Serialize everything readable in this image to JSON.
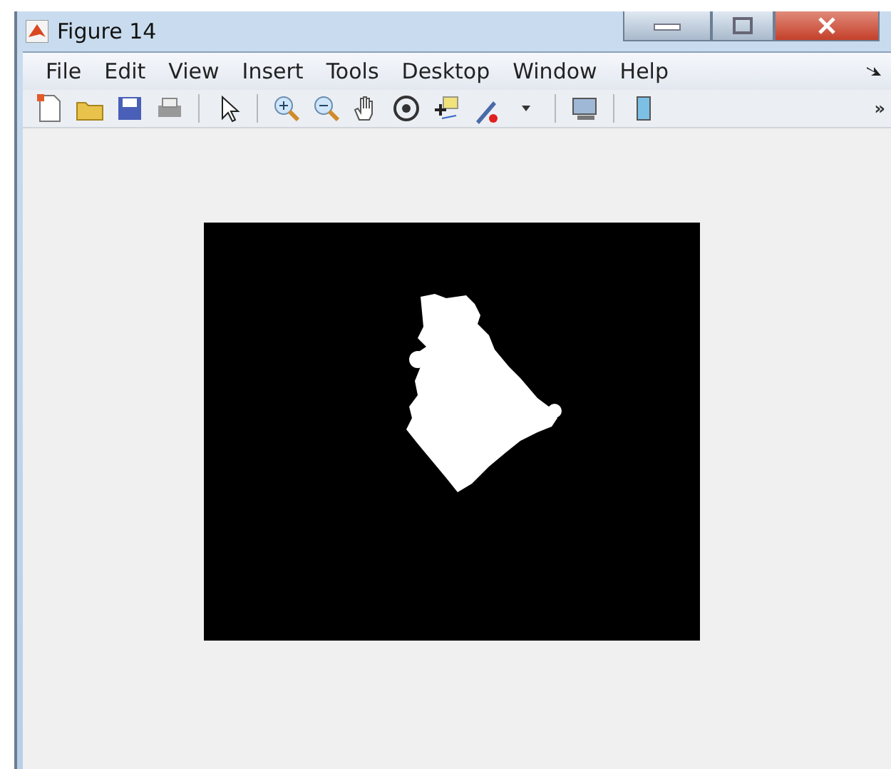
{
  "window": {
    "title": "Figure 14"
  },
  "menu": [
    "File",
    "Edit",
    "View",
    "Insert",
    "Tools",
    "Desktop",
    "Window",
    "Help"
  ],
  "toolbar": {
    "overflow": "»"
  }
}
